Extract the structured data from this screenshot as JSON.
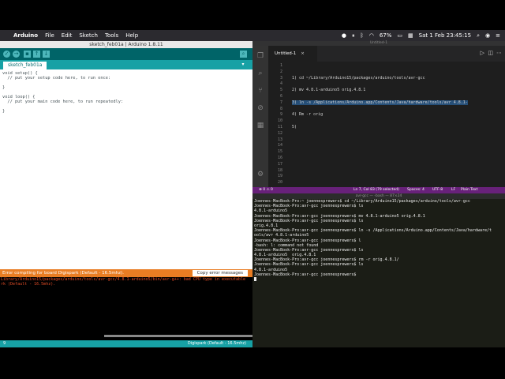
{
  "menubar": {
    "app": "Arduino",
    "items": [
      "File",
      "Edit",
      "Sketch",
      "Tools",
      "Help"
    ],
    "battery": "67%",
    "datetime": "Sat 1 Feb  23:45:15"
  },
  "arduino": {
    "window_title": "sketch_feb01a | Arduino 1.8.11",
    "tab": "sketch_feb01a",
    "code_lines": [
      "void setup() {",
      "  // put your setup code here, to run once:",
      "",
      "}",
      "",
      "void loop() {",
      "  // put your main code here, to run repeatedly:",
      "",
      "}"
    ],
    "error_title": "Error compiling for board Digispark (Default - 16.5mhz).",
    "copy_button": "Copy error messages",
    "console_lines": [
      "Library/Arduino15/packages/arduino/tools/avr-gcc/4.8.1-arduino5/bin/avr-g++: bad CPU type in executable",
      "rk (Default - 16.5mhz)."
    ],
    "status_line": "9",
    "status_board": "Digispark (Default - 16.5mhz)"
  },
  "vscode": {
    "window_title": "Untitled-1",
    "tab": "Untitled-1",
    "line_numbers": [
      "1",
      "2",
      "3",
      "4",
      "5",
      "6",
      "7",
      "8",
      "9",
      "10",
      "11",
      "12",
      "13",
      "14",
      "15",
      "16",
      "17",
      "18",
      "19",
      "20"
    ],
    "lines": [
      "",
      "",
      "1) cd ~/Library/Arduino15/packages/arduino/tools/avr-gcc",
      "",
      "2) mv 4.8.1-arduino5 orig.4.8.1",
      "",
      "3) ln -s /Applications/Arduino.app/Contents/Java/hardware/tools/avr 4.8.1-",
      "",
      "4) Rm -r orig",
      "",
      "5)",
      "",
      "",
      "",
      "",
      "",
      "",
      "",
      "",
      ""
    ],
    "status_left": "⊗ 0 ⚠ 0",
    "status_ln": "Ln 7, Col 83 (79 selected)",
    "status_spaces": "Spaces: 4",
    "status_enc": "UTF-8",
    "status_eol": "LF",
    "status_lang": "Plain Text"
  },
  "terminal": {
    "title": "avr-gcc — -bash — 87×24",
    "lines": [
      "Joennes-MacBook-Pro:~ joennesprewers$ cd ~/Library/Arduino15/packages/arduino/tools/avr-gcc",
      "Joennes-MacBook-Pro:avr-gcc joennesprewers$ ls",
      "4.8.1-arduino5",
      "Joennes-MacBook-Pro:avr-gcc joennesprewers$ mv 4.8.1-arduino5 orig.4.8.1",
      "Joennes-MacBook-Pro:avr-gcc joennesprewers$ ls",
      "orig.4.8.1",
      "Joennes-MacBook-Pro:avr-gcc joennesprewers$ ln -s /Applications/Arduino.app/Contents/Java/hardware/t",
      "ools/avr 4.8.1-arduino5",
      "Joennes-MacBook-Pro:avr-gcc joennesprewers$ l",
      "-bash: l: command not found",
      "Joennes-MacBook-Pro:avr-gcc joennesprewers$ ls",
      "4.8.1-arduino5  orig.4.8.1",
      "Joennes-MacBook-Pro:avr-gcc joennesprewers$ rm -r orig.4.8.1/",
      "Joennes-MacBook-Pro:avr-gcc joennesprewers$ ls",
      "4.8.1-arduino5",
      "Joennes-MacBook-Pro:avr-gcc joennesprewers$ "
    ]
  }
}
